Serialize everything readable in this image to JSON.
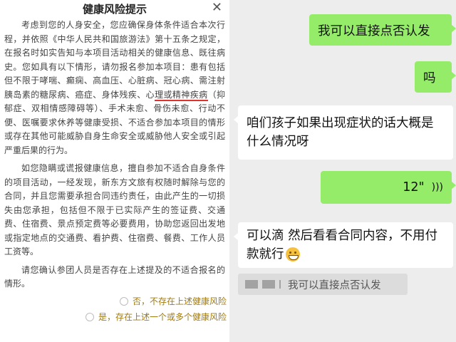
{
  "document": {
    "title": "健康风险提示",
    "close_icon": "close-icon",
    "paragraphs": [
      {
        "before": "考虑到您的人身安全，您应确保身体条件适合本次行程，并依照《中华人民共和国旅游法》第十五条之规定，在报名时如实告知与本项目活动相关的健康信息、既往病史。您如具有以下情形，请勿报名参加本项目：患有包括但不限于哮喘、癫痫、高血压、心脏病、冠心病、需注射胰岛素的糖尿病、癌症、身体残疾、心",
        "underlined": "理或精神疾病",
        "after": "（抑郁症、双相情感障碍等）、手术未愈、骨伤未愈、行动不便、医嘱要求休养等健康受损、不适合参加本项目的情形或存在其他可能威胁自身生命安全或威胁他人安全或引起严重后果的行为。"
      },
      {
        "text": "如您隐瞒或谎报健康信息，擅自参加不适合自身条件的项目活动，一经发现，新东方文旅有权随时解除与您的合同，并且您需要承担合同违约责任，由此产生的一切损失由您承担，包括但不限于已实际产生的签证费、交通费、住宿费、景点预定费等必要费用，协助您返回出发地或指定地点的交通费、看护费、住宿费、餐费、工作人员工资等。"
      },
      {
        "text": "请您确认参团人员是否存在上述提及的不适合报名的情形。"
      }
    ],
    "options": [
      {
        "label": "否，不存在上述健康风险"
      },
      {
        "label": "是，存在上述一个或多个健康风险"
      }
    ]
  },
  "chat": {
    "messages": [
      {
        "side": "sent",
        "text": "我可以直接点否认发"
      },
      {
        "side": "sent",
        "text": "吗"
      },
      {
        "side": "received",
        "text": "咱们孩子如果出现症状的话大概是什么情况呀"
      },
      {
        "side": "sent",
        "text": "12\"",
        "kind": "voice",
        "icon": "voice-wave-icon"
      },
      {
        "side": "received",
        "text": "可以滴 然后看看合同内容，不用付款就行",
        "emoji": "grinning-face-icon"
      }
    ],
    "quote": {
      "text": "我可以直接点否认发"
    }
  },
  "colors": {
    "sent_bubble": "#95ec69",
    "received_bubble": "#ffffff",
    "chat_background": "#ededed",
    "option_text": "#a07a10",
    "underline": "#e0332e"
  }
}
